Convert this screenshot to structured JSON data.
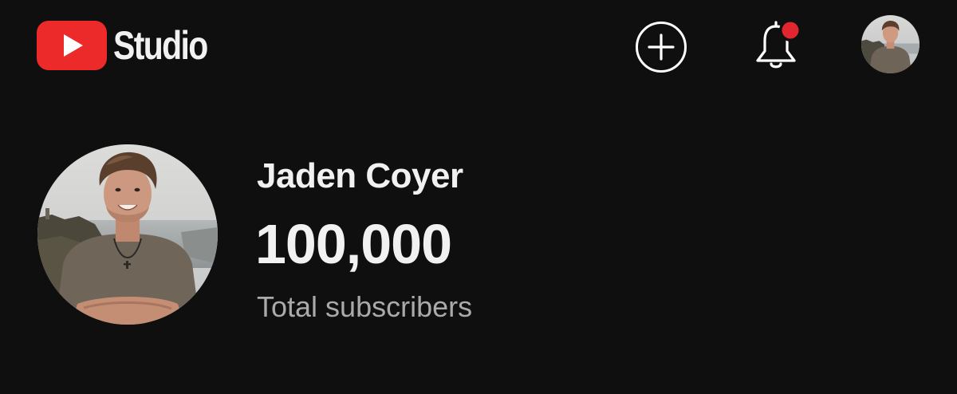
{
  "app": {
    "logo_text": "Studio",
    "brand_color": "#ff0000",
    "background_color": "#0f0f0f"
  },
  "header": {
    "create_icon": "plus-circle-icon",
    "notifications_icon": "bell-icon",
    "notifications_badge_color": "#e0262e",
    "account_icon": "account-avatar"
  },
  "channel": {
    "name": "Jaden Coyer",
    "subscriber_count": "100,000",
    "subscriber_label": "Total subscribers"
  }
}
